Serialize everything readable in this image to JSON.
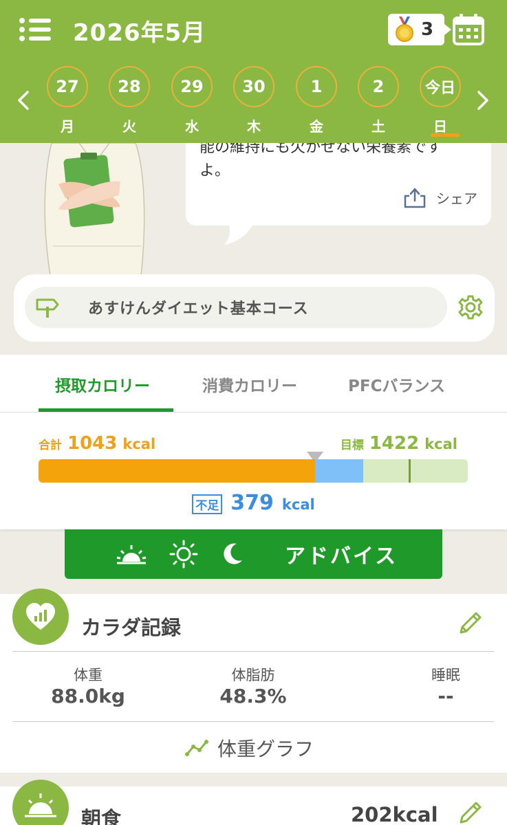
{
  "header": {
    "title": "2026年5月",
    "medal_count": "3",
    "days": [
      {
        "date": "27",
        "weekday": "月"
      },
      {
        "date": "28",
        "weekday": "火"
      },
      {
        "date": "29",
        "weekday": "水"
      },
      {
        "date": "30",
        "weekday": "木"
      },
      {
        "date": "1",
        "weekday": "金"
      },
      {
        "date": "2",
        "weekday": "土"
      },
      {
        "date": "今日",
        "weekday": "日"
      }
    ],
    "accent_color": "#8ab843"
  },
  "advice_bubble": {
    "line1": "能の維持にも欠かせない栄養素です",
    "line2": "よ。",
    "share_label": "シェア"
  },
  "course": {
    "name": "あすけんダイエット基本コース"
  },
  "tabs": [
    {
      "label": "摂取カロリー",
      "active": true
    },
    {
      "label": "消費カロリー",
      "active": false
    },
    {
      "label": "PFCバランス",
      "active": false
    }
  ],
  "calories": {
    "total_label": "合計",
    "total_value": "1043",
    "target_label": "目標",
    "target_value": "1422",
    "unit": "kcal",
    "shortage_label": "不足",
    "shortage_value": "379",
    "intake_fraction": 0.644,
    "target_fraction": 0.878
  },
  "advice_button": {
    "label": "アドバイス"
  },
  "body_record": {
    "title": "カラダ記録",
    "stats": [
      {
        "label": "体重",
        "value": "88.0kg"
      },
      {
        "label": "体脂肪",
        "value": "48.3%"
      },
      {
        "label": "睡眠",
        "value": "--"
      }
    ],
    "graph_link": "体重グラフ"
  },
  "breakfast": {
    "title": "朝食",
    "kcal": "202kcal"
  }
}
